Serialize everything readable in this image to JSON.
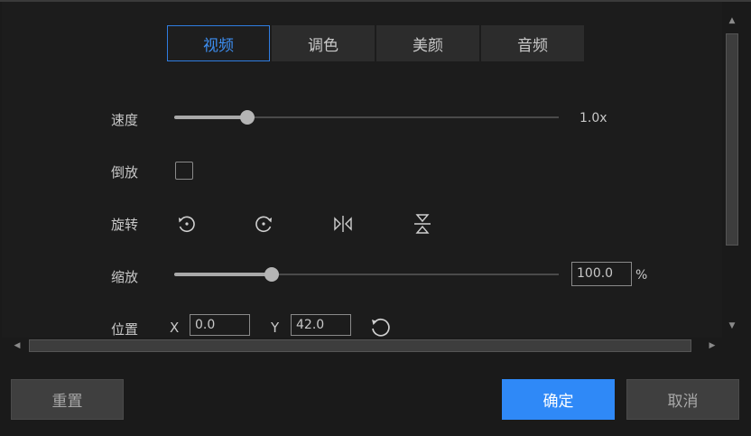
{
  "tabs": [
    {
      "label": "视频",
      "active": true
    },
    {
      "label": "调色",
      "active": false
    },
    {
      "label": "美颜",
      "active": false
    },
    {
      "label": "音频",
      "active": false
    }
  ],
  "speed": {
    "label": "速度",
    "value_text": "1.0x",
    "slider_fraction": 0.19
  },
  "reverse": {
    "label": "倒放",
    "checked": false
  },
  "rotate": {
    "label": "旋转",
    "buttons": [
      "rotate-left-icon",
      "rotate-right-icon",
      "flip-horizontal-icon",
      "flip-vertical-icon"
    ]
  },
  "scale": {
    "label": "缩放",
    "value": "100.0",
    "unit": "%",
    "slider_fraction": 0.253
  },
  "position": {
    "label": "位置",
    "x_label": "X",
    "x_value": "0.0",
    "y_label": "Y",
    "y_value": "42.0"
  },
  "footer": {
    "reset": "重置",
    "ok": "确定",
    "cancel": "取消"
  },
  "colors": {
    "accent": "#2f89f7",
    "tab_active_border": "#2f7de1"
  }
}
